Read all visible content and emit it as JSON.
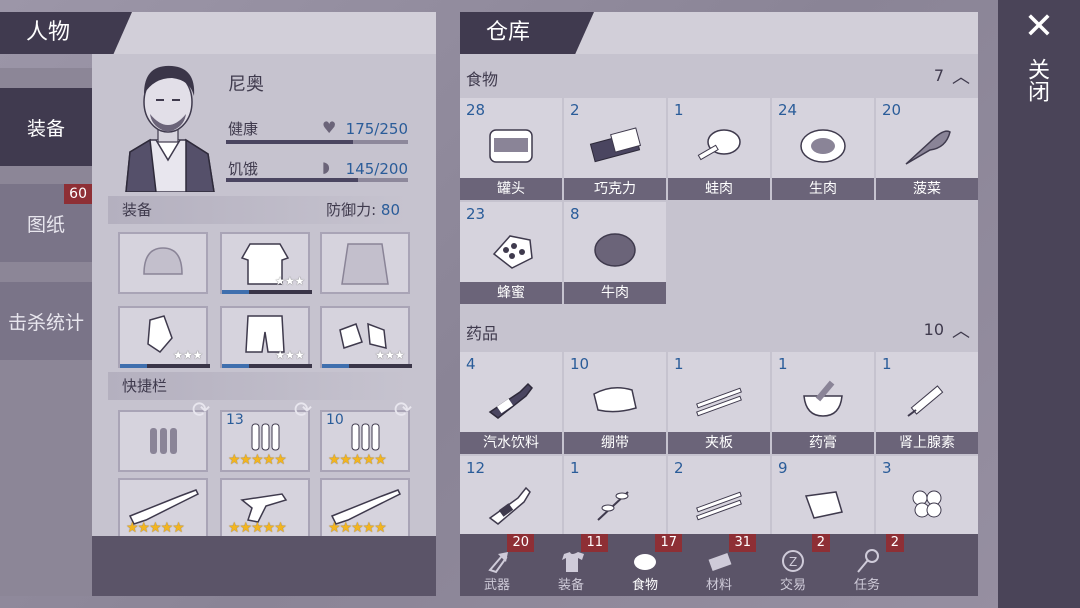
{
  "character_panel": {
    "title": "人物",
    "tabs": [
      {
        "label": "装备",
        "active": true
      },
      {
        "label": "图纸",
        "badge": "60"
      },
      {
        "label": "击杀统计"
      }
    ],
    "name": "尼奥",
    "health": {
      "label": "健康",
      "value": "175/250",
      "fraction": 0.7
    },
    "hunger": {
      "label": "饥饿",
      "value": "145/200",
      "fraction": 0.725
    },
    "equipment": {
      "label": "装备",
      "defense_label": "防御力:",
      "defense_value": "80"
    },
    "quickbar": {
      "label": "快捷栏"
    },
    "slots": [
      {
        "icon": "helmet-icon"
      },
      {
        "icon": "vest-icon",
        "stars": "★★★",
        "bar": 0.3
      },
      {
        "icon": "jacket-icon"
      },
      {
        "icon": "gloves-icon",
        "stars": "★★★",
        "bar": 0.3
      },
      {
        "icon": "pants-icon",
        "stars": "★★★",
        "bar": 0.3
      },
      {
        "icon": "shoes-icon",
        "stars": "★★★",
        "bar": 0.3
      }
    ],
    "quick_slots": [
      {
        "icon": "ammo-icon",
        "qty": ""
      },
      {
        "icon": "ammo-icon",
        "qty": "13",
        "stars": "★★★★★"
      },
      {
        "icon": "ammo-icon",
        "qty": "10",
        "stars": "★★★★★"
      },
      {
        "icon": "shotgun-icon",
        "stars": "★★★★★"
      },
      {
        "icon": "revolver-icon",
        "stars": "★★★★★"
      },
      {
        "icon": "shotgun-icon",
        "stars": "★★★★★"
      }
    ]
  },
  "warehouse": {
    "title": "仓库",
    "categories": [
      {
        "label": "食物",
        "count": "7",
        "items": [
          {
            "qty": "28",
            "label": "罐头",
            "icon": "can-icon"
          },
          {
            "qty": "2",
            "label": "巧克力",
            "icon": "chocolate-icon"
          },
          {
            "qty": "1",
            "label": "蛙肉",
            "icon": "frog-meat-icon"
          },
          {
            "qty": "24",
            "label": "生肉",
            "icon": "raw-meat-icon"
          },
          {
            "qty": "20",
            "label": "菠菜",
            "icon": "spinach-icon"
          },
          {
            "qty": "23",
            "label": "蜂蜜",
            "icon": "honeycomb-icon"
          },
          {
            "qty": "8",
            "label": "牛肉",
            "icon": "beef-icon"
          }
        ]
      },
      {
        "label": "药品",
        "count": "10",
        "items": [
          {
            "qty": "4",
            "label": "汽水饮料",
            "icon": "soda-icon"
          },
          {
            "qty": "10",
            "label": "绷带",
            "icon": "bandage-icon"
          },
          {
            "qty": "1",
            "label": "夹板",
            "icon": "splint-icon"
          },
          {
            "qty": "1",
            "label": "药膏",
            "icon": "mortar-icon"
          },
          {
            "qty": "1",
            "label": "肾上腺素",
            "icon": "syringe-icon"
          },
          {
            "qty": "12",
            "label": "",
            "icon": "beer-icon"
          },
          {
            "qty": "1",
            "label": "",
            "icon": "herb-icon"
          },
          {
            "qty": "2",
            "label": "",
            "icon": "splint-icon"
          },
          {
            "qty": "9",
            "label": "",
            "icon": "cast-icon"
          },
          {
            "qty": "3",
            "label": "",
            "icon": "clover-icon"
          }
        ]
      }
    ],
    "bottom_tabs": [
      {
        "label": "武器",
        "badge": "20",
        "icon": "axe-icon"
      },
      {
        "label": "装备",
        "badge": "11",
        "icon": "shirt-icon"
      },
      {
        "label": "食物",
        "badge": "17",
        "icon": "meat-icon",
        "active": true
      },
      {
        "label": "材料",
        "badge": "31",
        "icon": "material-icon"
      },
      {
        "label": "交易",
        "badge": "2",
        "icon": "coin-icon"
      },
      {
        "label": "任务",
        "badge": "2",
        "icon": "key-icon"
      }
    ]
  },
  "close": {
    "label": "关闭"
  }
}
